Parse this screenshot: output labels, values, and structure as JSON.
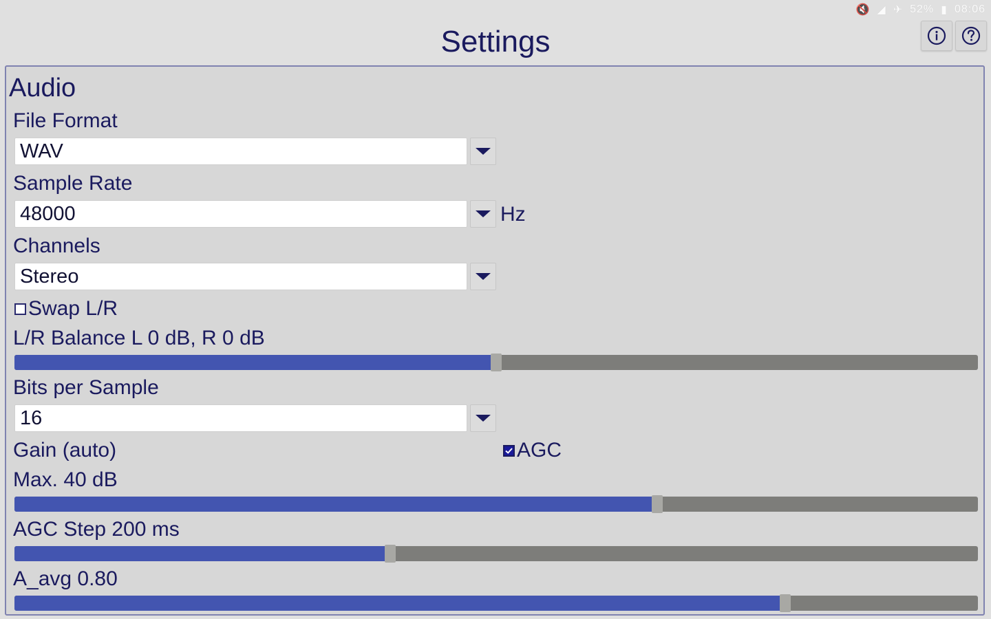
{
  "status": {
    "battery": "52%",
    "time": "08:06"
  },
  "header": {
    "title": "Settings"
  },
  "section": {
    "title": "Audio"
  },
  "file_format": {
    "label": "File Format",
    "value": "WAV"
  },
  "sample_rate": {
    "label": "Sample Rate",
    "value": "48000",
    "unit": "Hz"
  },
  "channels": {
    "label": "Channels",
    "value": "Stereo"
  },
  "swap_lr": {
    "label": "Swap L/R",
    "checked": false
  },
  "balance": {
    "label": "L/R Balance L 0 dB, R 0 dB",
    "fraction": 0.5
  },
  "bits": {
    "label": "Bits per Sample",
    "value": "16"
  },
  "gain": {
    "label": "Gain (auto)"
  },
  "agc": {
    "label": "AGC",
    "checked": true
  },
  "max_gain": {
    "label": "Max. 40 dB",
    "fraction": 0.667
  },
  "agc_step": {
    "label": "AGC Step 200 ms",
    "fraction": 0.39
  },
  "a_avg": {
    "label": "A_avg 0.80",
    "fraction": 0.8
  },
  "colors": {
    "text": "#1a1a5e",
    "slider_fill": "#4355b0",
    "slider_track": "#7d7d7a",
    "background": "#e0e0e0"
  }
}
